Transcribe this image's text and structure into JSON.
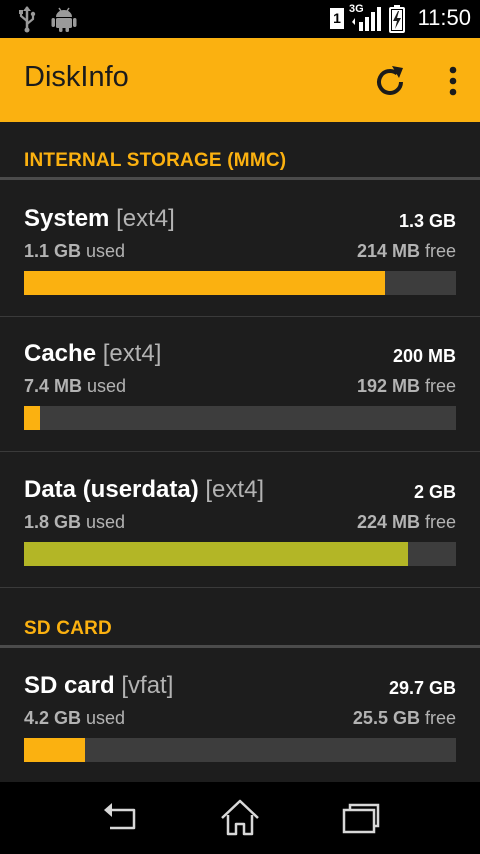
{
  "status_bar": {
    "time": "11:50",
    "network": "3G",
    "sim_badge": "1",
    "icons": [
      "usb-icon",
      "android-debug-icon",
      "sim-icon",
      "signal-icon",
      "battery-charging-icon"
    ]
  },
  "app_bar": {
    "title": "DiskInfo",
    "actions": [
      "refresh-icon",
      "overflow-menu-icon"
    ]
  },
  "sections": [
    {
      "header": "INTERNAL STORAGE (MMC)",
      "rows": [
        {
          "name": "System",
          "fs": "[ext4]",
          "total": "1.3 GB",
          "used_value": "1.1 GB",
          "used_suffix": " used",
          "free_value": "214 MB",
          "free_suffix": " free",
          "fill_percent": 83.5,
          "bar_color": "#fbb110"
        },
        {
          "name": "Cache",
          "fs": "[ext4]",
          "total": "200 MB",
          "used_value": "7.4 MB",
          "used_suffix": " used",
          "free_value": "192 MB",
          "free_suffix": " free",
          "fill_percent": 3.7,
          "bar_color": "#fbb110"
        },
        {
          "name": "Data (userdata)",
          "fs": "[ext4]",
          "total": "2 GB",
          "used_value": "1.8 GB",
          "used_suffix": " used",
          "free_value": "224 MB",
          "free_suffix": " free",
          "fill_percent": 89,
          "bar_color": "#b3b626"
        }
      ]
    },
    {
      "header": "SD CARD",
      "rows": [
        {
          "name": "SD card",
          "fs": "[vfat]",
          "total": "29.7 GB",
          "used_value": "4.2 GB",
          "used_suffix": " used",
          "free_value": "25.5 GB",
          "free_suffix": " free",
          "fill_percent": 14.1,
          "bar_color": "#fbb110"
        }
      ]
    }
  ],
  "nav_bar": {
    "buttons": [
      "back-icon",
      "home-icon",
      "recent-apps-icon"
    ]
  },
  "colors": {
    "accent": "#fbb110",
    "data_bar": "#b3b626",
    "background": "#1d1d1d",
    "bar_track": "#3d3d3d"
  }
}
